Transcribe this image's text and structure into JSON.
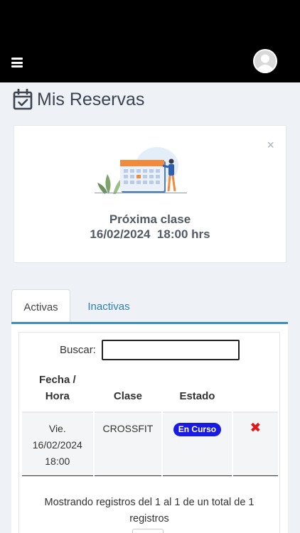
{
  "header": {
    "menu_icon": "hamburger-icon",
    "avatar_icon": "user-avatar-icon"
  },
  "page": {
    "title": "Mis Reservas",
    "title_icon": "calendar-check-icon"
  },
  "next_class": {
    "title": "Próxima clase",
    "date": "16/02/2024  18:00 hrs",
    "close_symbol": "×"
  },
  "tabs": [
    {
      "label": "Activas",
      "active": true
    },
    {
      "label": "Inactivas",
      "active": false
    }
  ],
  "search": {
    "label": "Buscar:",
    "value": ""
  },
  "table": {
    "headers": [
      "Fecha / Hora",
      "Clase",
      "Estado",
      ""
    ],
    "rows": [
      {
        "day": "Vie.",
        "date": "16/02/2024",
        "time": "18:00",
        "clase": "CROSSFIT",
        "estado": "En Curso",
        "delete_symbol": "✖"
      }
    ]
  },
  "info": "Mostrando registros del 1 al 1 de un total de 1 registros",
  "colors": {
    "accent": "#3c8dbc",
    "badge": "#1a1ae0",
    "delete": "#e0191c",
    "header_bg": "#000000"
  }
}
